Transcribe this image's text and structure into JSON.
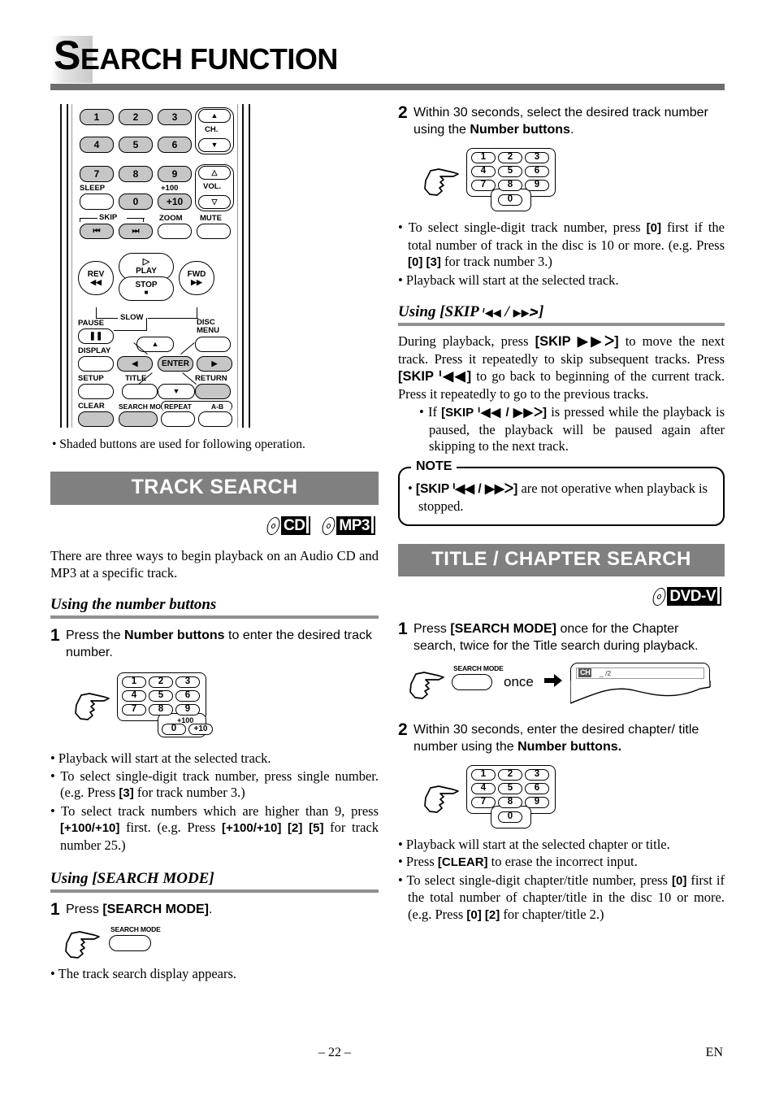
{
  "header": {
    "title_cap": "S",
    "title_rest": "EARCH FUNCTION"
  },
  "remote": {
    "caption": "• Shaded buttons are used for following operation.",
    "keys": [
      "1",
      "2",
      "3",
      "4",
      "5",
      "6",
      "7",
      "8",
      "9",
      "0",
      "+10"
    ],
    "labels": {
      "ch": "CH.",
      "vol": "VOL.",
      "sleep": "SLEEP",
      "plus100": "+100",
      "zoom": "ZOOM",
      "mute": "MUTE",
      "skip": "SKIP",
      "play": "PLAY",
      "rev": "REV",
      "fwd": "FWD",
      "stop": "STOP",
      "slow": "SLOW",
      "pause": "PAUSE",
      "display": "DISPLAY",
      "disc_menu_l1": "DISC",
      "disc_menu_l2": "MENU",
      "setup": "SETUP",
      "title": "TITLE",
      "return": "RETURN",
      "enter": "ENTER",
      "clear": "CLEAR",
      "search_mode": "SEARCH MODE",
      "repeat": "REPEAT",
      "ab": "A-B"
    }
  },
  "track_search": {
    "banner": "TRACK SEARCH",
    "logos": [
      {
        "name": "cd-logo",
        "text": "CD"
      },
      {
        "name": "mp3-logo",
        "text": "MP3"
      }
    ],
    "intro": "There are three ways to begin playback on an Audio CD and MP3 at a specific track.",
    "sub1": {
      "heading": "Using the number buttons",
      "step1_num": "1",
      "step1_text_a": "Press the ",
      "step1_bold": "Number buttons",
      "step1_text_b": " to enter the desired track number.",
      "keypad": {
        "keys": [
          "1",
          "2",
          "3",
          "4",
          "5",
          "6",
          "7",
          "8",
          "9"
        ],
        "zero": "0",
        "plusten": "+10",
        "plus100": "+100"
      },
      "bullets": [
        {
          "parts": [
            {
              "t": "Playback will start at the selected track.",
              "b": false
            }
          ]
        },
        {
          "parts": [
            {
              "t": "To select single-digit track number, press single number. (e.g. Press ",
              "b": false
            },
            {
              "t": "[3]",
              "b": true
            },
            {
              "t": " for track number 3.)",
              "b": false
            }
          ]
        },
        {
          "parts": [
            {
              "t": "To select track numbers which are higher than 9, press ",
              "b": false
            },
            {
              "t": "[+100/+10]",
              "b": true
            },
            {
              "t": " first. (e.g. Press ",
              "b": false
            },
            {
              "t": "[+100/+10] [2] [5]",
              "b": true
            },
            {
              "t": " for track number 25.)",
              "b": false
            }
          ]
        }
      ]
    },
    "sub2": {
      "heading": "Using [SEARCH MODE]",
      "step1_num": "1",
      "step1_text_a": "Press ",
      "step1_bold": "[SEARCH MODE]",
      "step1_text_b": ".",
      "button_label": "SEARCH MODE",
      "bullets": [
        {
          "parts": [
            {
              "t": "The track search display appears.",
              "b": false
            }
          ]
        }
      ]
    },
    "step2": {
      "num": "2",
      "text_a": "Within 30 seconds, select the desired track number using the ",
      "bold": "Number buttons",
      "text_b": ".",
      "keypad": {
        "keys": [
          "1",
          "2",
          "3",
          "4",
          "5",
          "6",
          "7",
          "8",
          "9"
        ],
        "zero": "0"
      },
      "bullets": [
        {
          "parts": [
            {
              "t": "To select single-digit track number, press ",
              "b": false
            },
            {
              "t": "[0]",
              "b": true
            },
            {
              "t": " first if the total number of track in the disc is 10 or more. (e.g. Press ",
              "b": false
            },
            {
              "t": "[0] [3]",
              "b": true
            },
            {
              "t": " for track number 3.)",
              "b": false
            }
          ]
        },
        {
          "parts": [
            {
              "t": "Playback will start at the selected track.",
              "b": false
            }
          ]
        }
      ]
    },
    "sub3": {
      "heading_a": "Using [SKIP ",
      "heading_prev": "ᑊ◀◀",
      "heading_sep": " / ",
      "heading_next": "▶▶ᐳ",
      "heading_b": "]",
      "para": [
        {
          "t": "During playback, press ",
          "b": false
        },
        {
          "t": "[SKIP ▶▶ᐳ]",
          "b": true
        },
        {
          "t": " to move the next track. Press it repeatedly to skip subsequent tracks. Press ",
          "b": false
        },
        {
          "t": "[SKIP ᑊ◀◀]",
          "b": true
        },
        {
          "t": " to go back to beginning of the current track. Press it repeatedly to go to the previous tracks.",
          "b": false
        }
      ],
      "bullets": [
        {
          "parts": [
            {
              "t": "If ",
              "b": false
            },
            {
              "t": "[SKIP ᑊ◀◀ / ▶▶ᐳ]",
              "b": true
            },
            {
              "t": " is pressed while the playback is paused, the playback will be paused again after skipping to the next track.",
              "b": false
            }
          ]
        }
      ],
      "note": {
        "caption": "NOTE",
        "bullets": [
          {
            "parts": [
              {
                "t": "[SKIP ᑊ◀◀ / ▶▶ᐳ]",
                "b": true
              },
              {
                "t": " are not operative when playback is stopped.",
                "b": false
              }
            ]
          }
        ]
      }
    }
  },
  "title_chapter_search": {
    "banner": "TITLE / CHAPTER SEARCH",
    "logos": [
      {
        "name": "dvd-v-logo",
        "text": "DVD-V"
      }
    ],
    "step1": {
      "num": "1",
      "text_a": "Press ",
      "bold": "[SEARCH MODE]",
      "text_b": " once for the Chapter search, twice for the Title search during playback.",
      "button_label": "SEARCH MODE",
      "once_word": "once",
      "display": {
        "ch": "CH",
        "value": "_ /2"
      }
    },
    "step2": {
      "num": "2",
      "text_a": "Within 30 seconds, enter the desired chapter/ title number using the ",
      "bold": "Number buttons.",
      "text_b": "",
      "keypad": {
        "keys": [
          "1",
          "2",
          "3",
          "4",
          "5",
          "6",
          "7",
          "8",
          "9"
        ],
        "zero": "0"
      },
      "bullets": [
        {
          "parts": [
            {
              "t": "Playback will start at the selected chapter or title.",
              "b": false
            }
          ]
        },
        {
          "parts": [
            {
              "t": "Press ",
              "b": false
            },
            {
              "t": "[CLEAR]",
              "b": true
            },
            {
              "t": " to erase the incorrect input.",
              "b": false
            }
          ]
        },
        {
          "parts": [
            {
              "t": "To select single-digit chapter/title number, press ",
              "b": false
            },
            {
              "t": "[0]",
              "b": true
            },
            {
              "t": " first if the total number of chapter/title in the disc 10 or more. (e.g. Press ",
              "b": false
            },
            {
              "t": "[0] [2]",
              "b": true
            },
            {
              "t": " for chapter/title 2.)",
              "b": false
            }
          ]
        }
      ]
    }
  },
  "footer": {
    "page": "– 22 –",
    "lang": "EN"
  }
}
